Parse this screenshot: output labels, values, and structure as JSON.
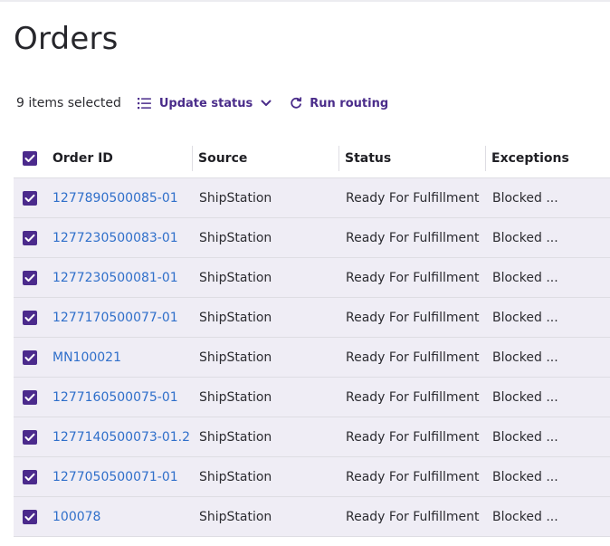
{
  "page": {
    "title": "Orders"
  },
  "toolbar": {
    "selected_label": "9 items selected",
    "update_status_label": "Update status",
    "run_routing_label": "Run routing"
  },
  "table": {
    "headers": {
      "order_id": "Order ID",
      "source": "Source",
      "status": "Status",
      "exceptions": "Exceptions"
    },
    "rows": [
      {
        "order_id": "1277890500085-01",
        "source": "ShipStation",
        "status": "Ready For Fulfillment",
        "exceptions": "Blocked ...",
        "checked": true
      },
      {
        "order_id": "1277230500083-01",
        "source": "ShipStation",
        "status": "Ready For Fulfillment",
        "exceptions": "Blocked ...",
        "checked": true
      },
      {
        "order_id": "1277230500081-01",
        "source": "ShipStation",
        "status": "Ready For Fulfillment",
        "exceptions": "Blocked ...",
        "checked": true
      },
      {
        "order_id": "1277170500077-01",
        "source": "ShipStation",
        "status": "Ready For Fulfillment",
        "exceptions": "Blocked ...",
        "checked": true
      },
      {
        "order_id": "MN100021",
        "source": "ShipStation",
        "status": "Ready For Fulfillment",
        "exceptions": "Blocked ...",
        "checked": true
      },
      {
        "order_id": "1277160500075-01",
        "source": "ShipStation",
        "status": "Ready For Fulfillment",
        "exceptions": "Blocked ...",
        "checked": true
      },
      {
        "order_id": "1277140500073-01.2",
        "source": "ShipStation",
        "status": "Ready For Fulfillment",
        "exceptions": "Blocked ...",
        "checked": true
      },
      {
        "order_id": "1277050500071-01",
        "source": "ShipStation",
        "status": "Ready For Fulfillment",
        "exceptions": "Blocked ...",
        "checked": true
      },
      {
        "order_id": "100078",
        "source": "ShipStation",
        "status": "Ready For Fulfillment",
        "exceptions": "Blocked ...",
        "checked": true
      }
    ]
  },
  "colors": {
    "accent": "#4b2a8c",
    "link": "#2f6fca",
    "row_selected_bg": "#efedf5"
  },
  "icons": {
    "update_status": "list-icon",
    "dropdown": "chevron-down-icon",
    "run_routing": "refresh-icon",
    "checkbox": "checkmark-icon"
  }
}
